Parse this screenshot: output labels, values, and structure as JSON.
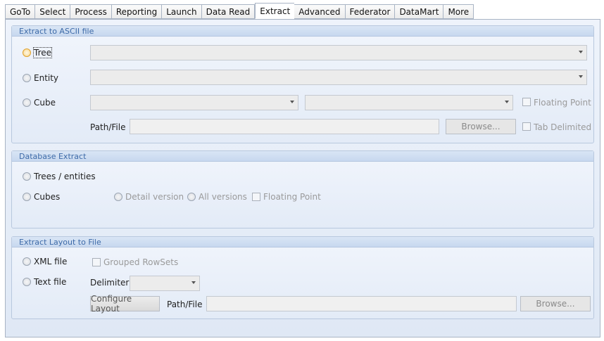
{
  "tabs": [
    "GoTo",
    "Select",
    "Process",
    "Reporting",
    "Launch",
    "Data Read",
    "Extract",
    "Advanced",
    "Federator",
    "DataMart",
    "More"
  ],
  "active_tab": "Extract",
  "ascii": {
    "title": "Extract to ASCII file",
    "tree_label": "Tree",
    "entity_label": "Entity",
    "cube_label": "Cube",
    "floating_point": "Floating Point",
    "path_label": "Path/File",
    "browse": "Browse...",
    "tab_delimited": "Tab Delimited"
  },
  "db": {
    "title": "Database Extract",
    "trees_entities": "Trees / entities",
    "cubes": "Cubes",
    "detail_version": "Detail version",
    "all_versions": "All versions",
    "floating_point": "Floating Point"
  },
  "layout": {
    "title": "Extract Layout to File",
    "xml_file": "XML file",
    "grouped_rowsets": "Grouped RowSets",
    "text_file": "Text file",
    "delimiter": "Delimiter:",
    "configure": "Configure Layout",
    "path_label": "Path/File",
    "browse": "Browse..."
  }
}
